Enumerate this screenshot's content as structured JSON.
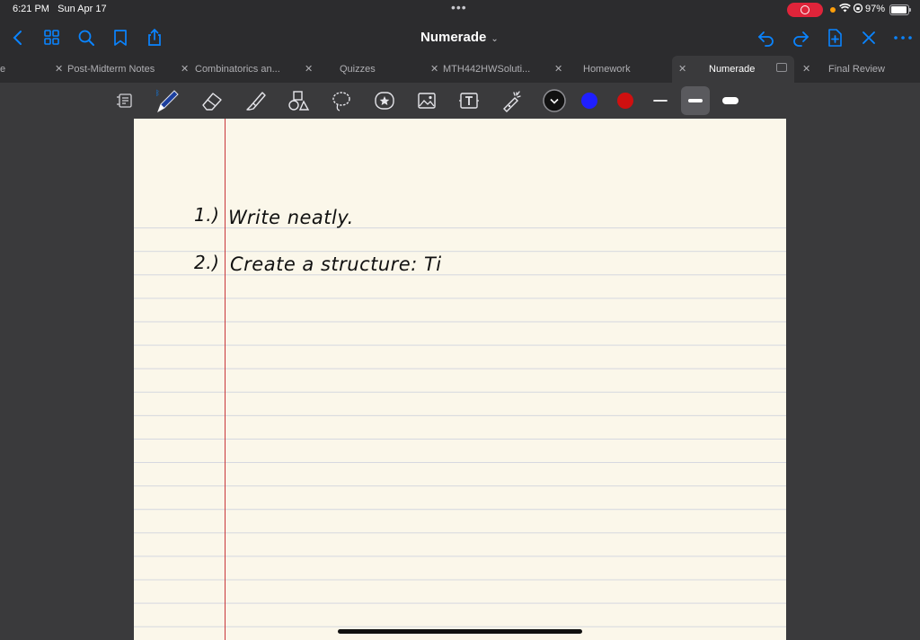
{
  "status_bar": {
    "time": "6:21 PM",
    "date": "Sun Apr 17",
    "battery": "97%"
  },
  "nav": {
    "title": "Numerade"
  },
  "tabs": [
    {
      "label": "Post-Midterm Notes"
    },
    {
      "label": "Combinatorics an..."
    },
    {
      "label": "Quizzes"
    },
    {
      "label": "MTH442HWSoluti..."
    },
    {
      "label": "Homework"
    },
    {
      "label": "Numerade",
      "active": true
    },
    {
      "label": "Final Review"
    }
  ],
  "toolbar": {
    "colors": {
      "black": "#111111",
      "blue": "#1f1fff",
      "red": "#d01010"
    },
    "selected_stroke": "medium"
  },
  "page": {
    "lines": [
      {
        "number": "1.)",
        "text": "Write neatly."
      },
      {
        "number": "2.)",
        "text": "Create a structure: Ti"
      }
    ]
  },
  "colors": {
    "accent": "#0a84ff",
    "paper": "#fbf7ea",
    "margin": "#c8373a",
    "record": "#e0243a"
  }
}
